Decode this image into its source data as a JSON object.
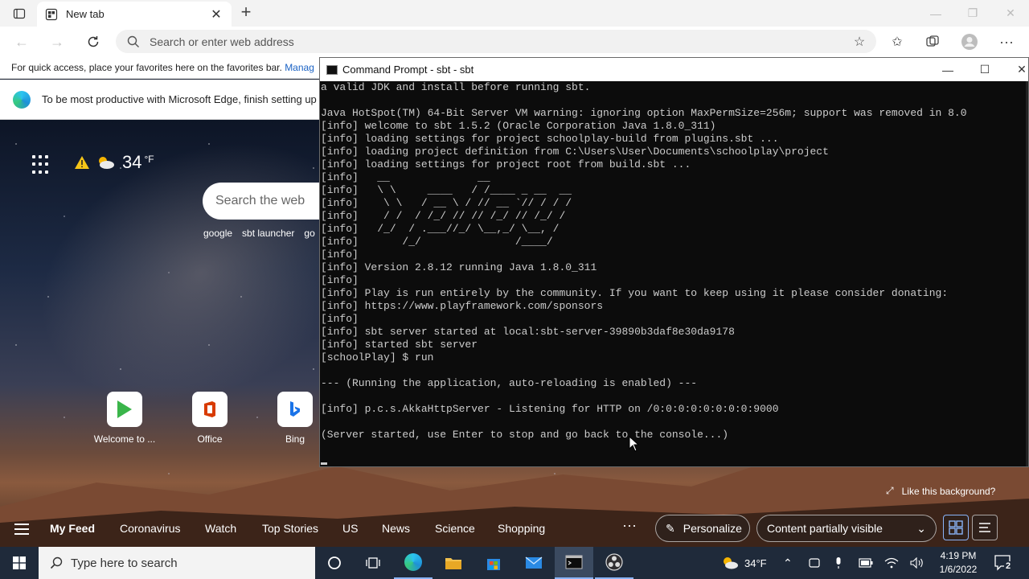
{
  "browser": {
    "tab_title": "New tab",
    "address_placeholder": "Search or enter web address",
    "favorites_bar_text": "For quick access, place your favorites here on the favorites bar.",
    "favorites_bar_link": "Manag",
    "infobar_text": "To be most productive with Microsoft Edge, finish setting up"
  },
  "ntp": {
    "weather_temp": "34",
    "weather_unit": "°F",
    "search_placeholder": "Search the web",
    "quick_links": [
      "google",
      "sbt launcher",
      "go"
    ],
    "tiles": [
      {
        "label": "Welcome to ..."
      },
      {
        "label": "Office"
      },
      {
        "label": "Bing"
      }
    ],
    "like_background": "Like this background?",
    "feed": {
      "items": [
        "My Feed",
        "Coronavirus",
        "Watch",
        "Top Stories",
        "US",
        "News",
        "Science",
        "Shopping"
      ],
      "personalize": "Personalize",
      "content_visibility": "Content partially visible"
    }
  },
  "cmd": {
    "title": "Command Prompt - sbt - sbt",
    "lines": [
      "a valid JDK and install before running sbt.",
      "",
      "Java HotSpot(TM) 64-Bit Server VM warning: ignoring option MaxPermSize=256m; support was removed in 8.0",
      "[info] welcome to sbt 1.5.2 (Oracle Corporation Java 1.8.0_311)",
      "[info] loading settings for project schoolplay-build from plugins.sbt ...",
      "[info] loading project definition from C:\\Users\\User\\Documents\\schoolplay\\project",
      "[info] loading settings for project root from build.sbt ...",
      "[info]   __              __",
      "[info]   \\ \\     ____   / /____ _ __  __",
      "[info]    \\ \\   / __ \\ / // __ `// / / /",
      "[info]    / /  / /_/ // // /_/ // /_/ /",
      "[info]   /_/  / .___//_/ \\__,_/ \\__, /",
      "[info]       /_/               /____/",
      "[info]",
      "[info] Version 2.8.12 running Java 1.8.0_311",
      "[info]",
      "[info] Play is run entirely by the community. If you want to keep using it please consider donating:",
      "[info] https://www.playframework.com/sponsors",
      "[info]",
      "[info] sbt server started at local:sbt-server-39890b3daf8e30da9178",
      "[info] started sbt server",
      "[schoolPlay] $ run",
      "",
      "--- (Running the application, auto-reloading is enabled) ---",
      "",
      "[info] p.c.s.AkkaHttpServer - Listening for HTTP on /0:0:0:0:0:0:0:0:9000",
      "",
      "(Server started, use Enter to stop and go back to the console...)"
    ]
  },
  "taskbar": {
    "search_placeholder": "Type here to search",
    "weather": "34°F",
    "time": "4:19 PM",
    "date": "1/6/2022",
    "notification_count": "2"
  },
  "colors": {
    "cmd_background": "#0c0c0c",
    "cmd_text": "#cccccc",
    "taskbar": "#1f2a3a",
    "link": "#1a62c4"
  }
}
